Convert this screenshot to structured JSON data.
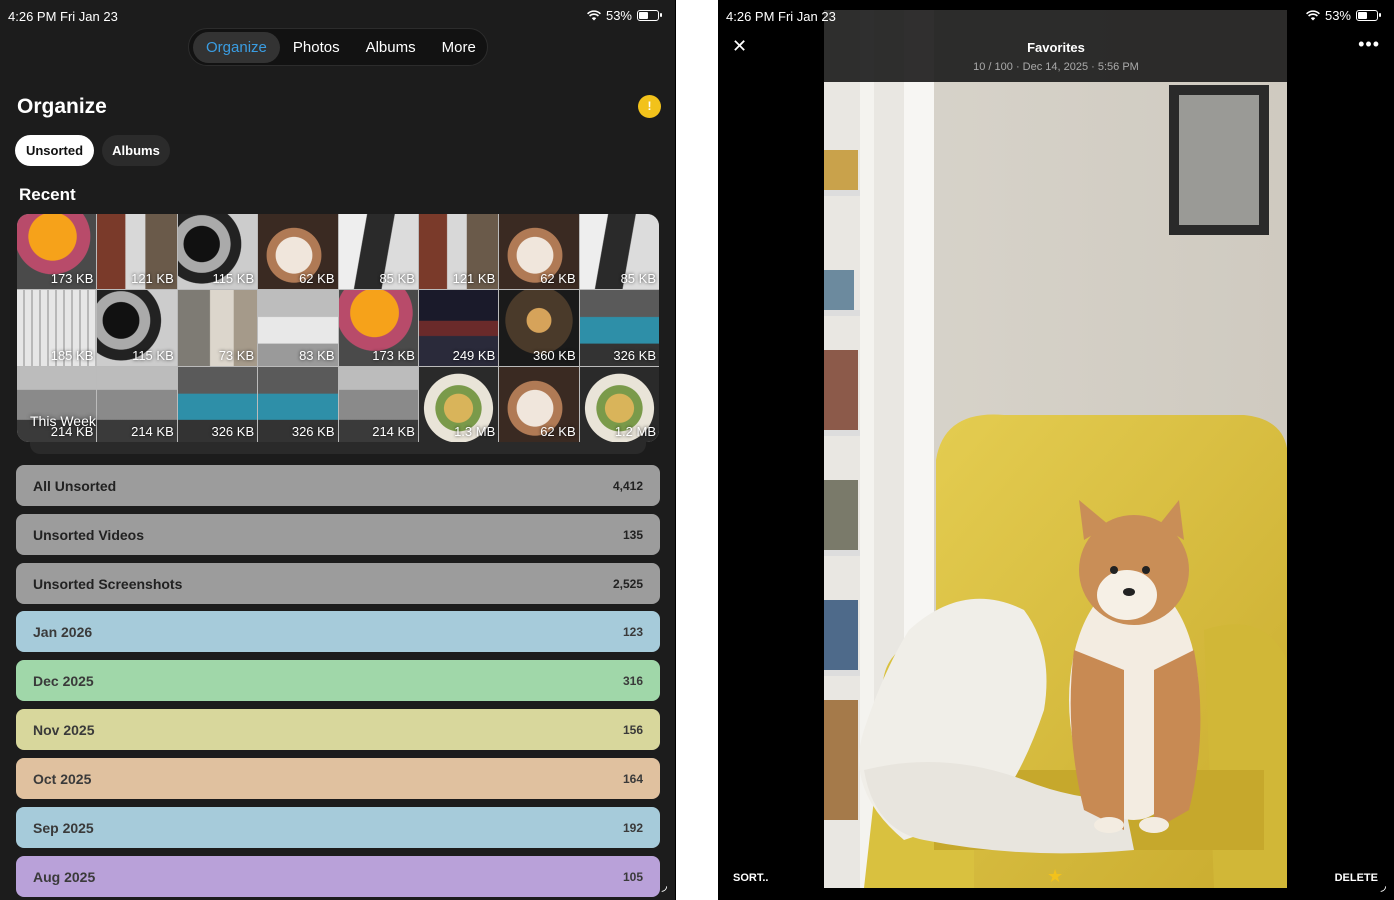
{
  "left": {
    "status": {
      "time": "4:26 PM",
      "date": "Fri Jan 23",
      "battery": "53%",
      "battery_level": 0.53
    },
    "tabs": [
      {
        "label": "Organize",
        "active": true
      },
      {
        "label": "Photos",
        "active": false
      },
      {
        "label": "Albums",
        "active": false
      },
      {
        "label": "More",
        "active": false
      }
    ],
    "title": "Organize",
    "alert_icon": "!",
    "pills": {
      "unsorted": "Unsorted",
      "albums": "Albums"
    },
    "recent_label": "Recent",
    "week_label": "This Week",
    "thumbs": [
      {
        "size": "173 KB",
        "kind": "orange-drink"
      },
      {
        "size": "121 KB",
        "kind": "brick-alley"
      },
      {
        "size": "115 KB",
        "kind": "leaves"
      },
      {
        "size": "62 KB",
        "kind": "coffee"
      },
      {
        "size": "85 KB",
        "kind": "bottle"
      },
      {
        "size": "121 KB",
        "kind": "brick-alley"
      },
      {
        "size": "62 KB",
        "kind": "coffee"
      },
      {
        "size": "85 KB",
        "kind": "bottle"
      },
      {
        "size": "185 KB",
        "kind": "building"
      },
      {
        "size": "115 KB",
        "kind": "leaves"
      },
      {
        "size": "73 KB",
        "kind": "room"
      },
      {
        "size": "83 KB",
        "kind": "bed"
      },
      {
        "size": "173 KB",
        "kind": "orange-drink"
      },
      {
        "size": "249 KB",
        "kind": "city-night"
      },
      {
        "size": "360 KB",
        "kind": "cafe-lights"
      },
      {
        "size": "326 KB",
        "kind": "blue-car"
      },
      {
        "size": "214 KB",
        "kind": "silver-car"
      },
      {
        "size": "214 KB",
        "kind": "silver-car"
      },
      {
        "size": "326 KB",
        "kind": "blue-car"
      },
      {
        "size": "326 KB",
        "kind": "blue-car"
      },
      {
        "size": "214 KB",
        "kind": "silver-car"
      },
      {
        "size": "1.3 MB",
        "kind": "food"
      },
      {
        "size": "62 KB",
        "kind": "coffee"
      },
      {
        "size": "1.2 MB",
        "kind": "food"
      }
    ],
    "rows": [
      {
        "label": "All Unsorted",
        "count": "4,412",
        "color": "#9c9c9c"
      },
      {
        "label": "Unsorted Videos",
        "count": "135",
        "color": "#9c9c9c"
      },
      {
        "label": "Unsorted Screenshots",
        "count": "2,525",
        "color": "#9c9c9c"
      },
      {
        "label": "Jan 2026",
        "count": "123",
        "color": "#a6cbda"
      },
      {
        "label": "Dec 2025",
        "count": "316",
        "color": "#a0d7a9"
      },
      {
        "label": "Nov 2025",
        "count": "156",
        "color": "#d8d79c"
      },
      {
        "label": "Oct 2025",
        "count": "164",
        "color": "#e0c19f"
      },
      {
        "label": "Sep 2025",
        "count": "192",
        "color": "#a6cbda"
      },
      {
        "label": "Aug 2025",
        "count": "105",
        "color": "#b9a1d9"
      }
    ]
  },
  "right": {
    "status": {
      "time": "4:26 PM",
      "date": "Fri Jan 23",
      "battery": "53%",
      "battery_level": 0.53
    },
    "title": "Favorites",
    "subtitle": "10 / 100 · Dec 14, 2025 · 5:56 PM",
    "sort_label": "SORT..",
    "delete_label": "DELETE",
    "star_icon": "★",
    "close_icon": "✕",
    "more_icon": "•••"
  }
}
